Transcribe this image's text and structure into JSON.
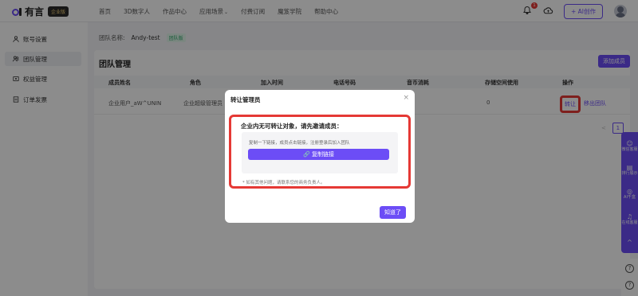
{
  "logo": {
    "text": "有言",
    "badge": "企业版"
  },
  "nav": [
    {
      "label": "首页"
    },
    {
      "label": "3D数字人"
    },
    {
      "label": "作品中心"
    },
    {
      "label": "应用场景"
    },
    {
      "label": "付费订阅"
    },
    {
      "label": "魔笈学院"
    },
    {
      "label": "帮助中心"
    }
  ],
  "nav_caret": "⌄",
  "header": {
    "notification_count": "1",
    "ai_create_label": "+ AI创作"
  },
  "sidebar": {
    "items": [
      {
        "label": "账号设置",
        "icon": "user-icon"
      },
      {
        "label": "团队管理",
        "icon": "team-icon",
        "active": true
      },
      {
        "label": "权益管理",
        "icon": "benefit-icon"
      },
      {
        "label": "订单发票",
        "icon": "order-icon"
      }
    ]
  },
  "team": {
    "name_label": "团队名称:",
    "name_value": "Andy-test",
    "tag": "团队版"
  },
  "card": {
    "title": "团队管理",
    "add_member_label": "添加成员"
  },
  "table": {
    "columns": [
      "成员姓名",
      "角色",
      "加入时间",
      "电话号码",
      "音币消耗",
      "存储空间使用",
      "操作"
    ],
    "rows": [
      {
        "name": "企业用户_aW^UNIN",
        "role": "企业超级管理员",
        "storage": "0",
        "transfer": "转让",
        "remove": "移出团队"
      }
    ]
  },
  "pagination": {
    "prev": "<",
    "current": "1"
  },
  "float_bar": [
    {
      "label": "微信客服",
      "icon": "wechat-icon"
    },
    {
      "label": "排行展示",
      "icon": "rank-icon"
    },
    {
      "label": "AI千盒",
      "icon": "bulb-icon"
    },
    {
      "label": "在线客服",
      "icon": "headset-icon"
    },
    {
      "label": "^",
      "icon": "up-icon"
    }
  ],
  "help_icons": [
    "?",
    "?"
  ],
  "modal": {
    "title": "转让管理员",
    "close": "×",
    "heading": "企业内无可转让对象，请先邀请成员：",
    "desc": "复制一下链接，成员点击链接，注册登录后加入团队",
    "copy_label": "🔗 复制链接",
    "note": "* 如有其他问题，请联系您的商务负责人。",
    "ok_label": "知道了"
  },
  "colors": {
    "accent": "#6c4df6",
    "highlight": "#e53935"
  }
}
